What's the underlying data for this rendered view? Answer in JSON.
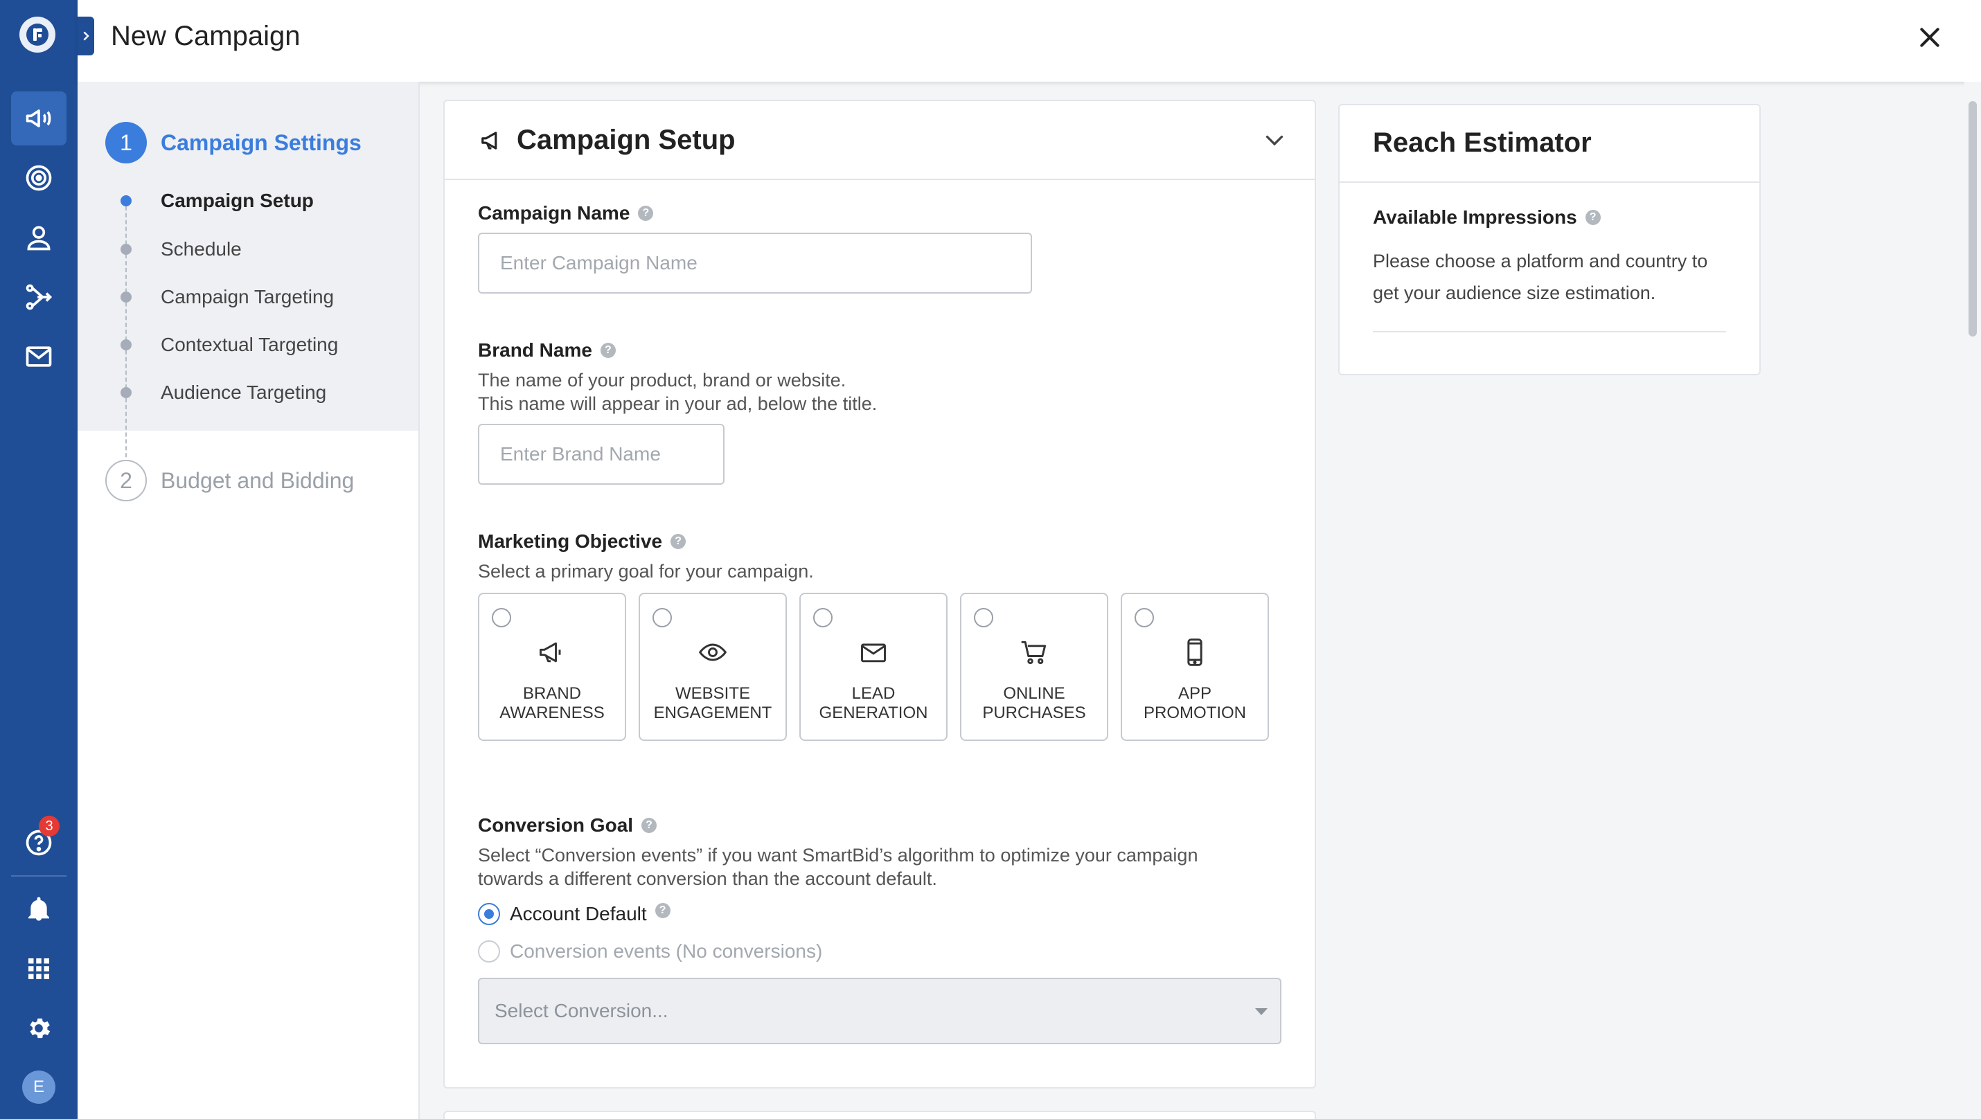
{
  "header": {
    "title": "New Campaign"
  },
  "rail": {
    "help_badge": "3",
    "avatar_initial": "E"
  },
  "steps": {
    "items": [
      {
        "number": "1",
        "label": "Campaign Settings",
        "substeps": [
          "Campaign Setup",
          "Schedule",
          "Campaign Targeting",
          "Contextual Targeting",
          "Audience Targeting"
        ]
      },
      {
        "number": "2",
        "label": "Budget and Bidding"
      }
    ]
  },
  "setup": {
    "title": "Campaign Setup",
    "campaign_name": {
      "label": "Campaign Name",
      "placeholder": "Enter Campaign Name",
      "value": ""
    },
    "brand_name": {
      "label": "Brand Name",
      "description_line1": "The name of your product, brand or website.",
      "description_line2": "This name will appear in your ad, below the title.",
      "placeholder": "Enter Brand Name",
      "value": ""
    },
    "objective": {
      "label": "Marketing Objective",
      "description": "Select a primary goal for your campaign.",
      "options": [
        {
          "label": "BRAND\nAWARENESS",
          "icon": "megaphone-icon"
        },
        {
          "label": "WEBSITE\nENGAGEMENT",
          "icon": "eye-icon"
        },
        {
          "label": "LEAD\nGENERATION",
          "icon": "envelope-icon"
        },
        {
          "label": "ONLINE\nPURCHASES",
          "icon": "cart-icon"
        },
        {
          "label": "APP\nPROMOTION",
          "icon": "phone-icon"
        }
      ]
    },
    "conversion": {
      "label": "Conversion Goal",
      "description_line1": "Select “Conversion events” if you want SmartBid’s algorithm to optimize your campaign",
      "description_line2": "towards a different conversion than the account default.",
      "option_default": "Account Default",
      "option_events": "Conversion events (No conversions)",
      "select_placeholder": "Select Conversion..."
    }
  },
  "reach": {
    "title": "Reach Estimator",
    "label": "Available Impressions",
    "text": "Please choose a platform and country to get your audience size estimation."
  },
  "colors": {
    "rail": "#1f4e96",
    "accent": "#3b7ddd",
    "badge": "#e53935"
  }
}
